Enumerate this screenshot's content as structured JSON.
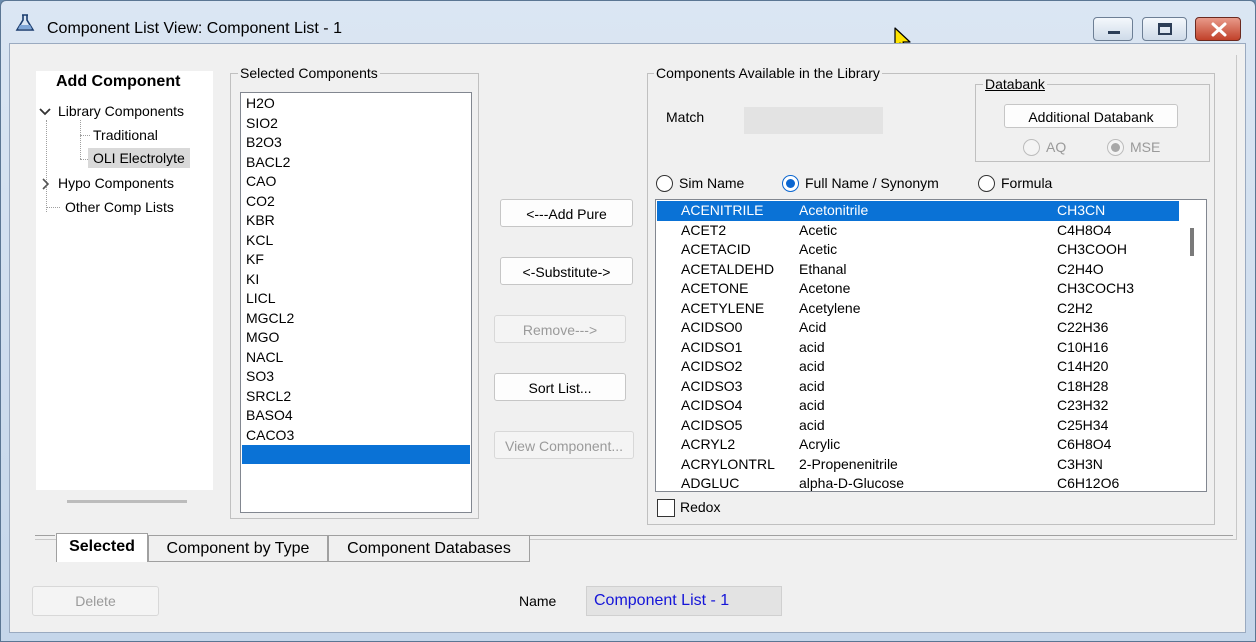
{
  "window": {
    "title": "Component List View: Component List - 1",
    "caption_buttons": {
      "minimize_icon": "minimize-icon",
      "maximize_icon": "maximize-icon",
      "close_icon": "close-icon"
    }
  },
  "tree": {
    "title": "Add Component",
    "nodes": [
      {
        "label": "Library Components",
        "expanded": true
      },
      {
        "label": "Traditional"
      },
      {
        "label": "OLI Electrolyte",
        "selected": true
      },
      {
        "label": "Hypo Components",
        "expanded": false
      },
      {
        "label": "Other Comp Lists"
      }
    ]
  },
  "selected_components": {
    "group_label": "Selected Components",
    "items": [
      "H2O",
      "SIO2",
      "B2O3",
      "BACL2",
      "CAO",
      "CO2",
      "KBR",
      "KCL",
      "KF",
      "KI",
      "LICL",
      "MGCL2",
      "MGO",
      "NACL",
      "SO3",
      "SRCL2",
      "BASO4",
      "CACO3",
      ""
    ]
  },
  "actions": {
    "add_pure": "<---Add Pure",
    "substitute": "<-Substitute->",
    "remove": "Remove--->",
    "sort_list": "Sort List...",
    "view_component": "View Component..."
  },
  "library": {
    "group_label": "Components Available in the Library",
    "match_label": "Match",
    "match_value": "",
    "databank": {
      "group_label": "Databank",
      "additional_button": "Additional Databank",
      "options": [
        {
          "label": "AQ",
          "checked": false
        },
        {
          "label": "MSE",
          "checked": true
        }
      ]
    },
    "search_modes": [
      {
        "label": "Sim Name",
        "checked": false
      },
      {
        "label": "Full Name / Synonym",
        "checked": true
      },
      {
        "label": "Formula",
        "checked": false
      }
    ],
    "rows": [
      {
        "sim": "ACENITRILE",
        "full": "Acetonitrile",
        "formula": "CH3CN",
        "selected": true
      },
      {
        "sim": "ACET2",
        "full": "Acetic",
        "formula": "C4H8O4"
      },
      {
        "sim": "ACETACID",
        "full": "Acetic",
        "formula": "CH3COOH"
      },
      {
        "sim": "ACETALDEHD",
        "full": "Ethanal",
        "formula": "C2H4O"
      },
      {
        "sim": "ACETONE",
        "full": "Acetone",
        "formula": "CH3COCH3"
      },
      {
        "sim": "ACETYLENE",
        "full": "Acetylene",
        "formula": "C2H2"
      },
      {
        "sim": "ACIDSO0",
        "full": "Acid",
        "formula": "C22H36"
      },
      {
        "sim": "ACIDSO1",
        "full": "acid",
        "formula": "C10H16"
      },
      {
        "sim": "ACIDSO2",
        "full": "acid",
        "formula": "C14H20"
      },
      {
        "sim": "ACIDSO3",
        "full": "acid",
        "formula": "C18H28"
      },
      {
        "sim": "ACIDSO4",
        "full": "acid",
        "formula": "C23H32"
      },
      {
        "sim": "ACIDSO5",
        "full": "acid",
        "formula": "C25H34"
      },
      {
        "sim": "ACRYL2",
        "full": "Acrylic",
        "formula": "C6H8O4"
      },
      {
        "sim": "ACRYLONTRL",
        "full": "2-Propenenitrile",
        "formula": "C3H3N"
      },
      {
        "sim": "ADGLUC",
        "full": "alpha-D-Glucose",
        "formula": "C6H12O6"
      }
    ],
    "redox_label": "Redox",
    "redox_checked": false
  },
  "tabs": [
    {
      "label": "Selected",
      "active": true
    },
    {
      "label": "Component by Type",
      "active": false
    },
    {
      "label": "Component Databases",
      "active": false
    }
  ],
  "footer": {
    "delete_label": "Delete",
    "name_label": "Name",
    "name_value": "Component List - 1"
  },
  "colors": {
    "selection": "#0a72d6",
    "name_text": "#1515d8",
    "radio_checked": "#0b66d0"
  }
}
